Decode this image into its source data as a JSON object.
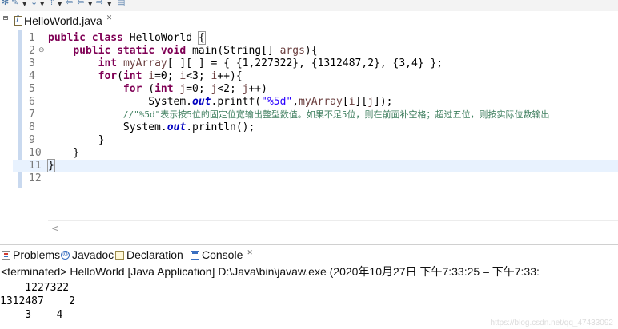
{
  "editor": {
    "tab_label": "HelloWorld.java",
    "tab_close": "✕",
    "lines": [
      {
        "num": "1",
        "fold": "",
        "segments": [
          [
            "kw",
            "public class "
          ],
          [
            "",
            "HelloWorld "
          ],
          [
            "brace",
            "{"
          ]
        ]
      },
      {
        "num": "2",
        "fold": "⊖",
        "segments": [
          [
            "",
            "    "
          ],
          [
            "kw",
            "public static void "
          ],
          [
            "",
            "main(String[] "
          ],
          [
            "var",
            "args"
          ],
          [
            "",
            "){"
          ]
        ]
      },
      {
        "num": "3",
        "fold": "",
        "segments": [
          [
            "",
            "        "
          ],
          [
            "kw",
            "int "
          ],
          [
            "var",
            "myArray"
          ],
          [
            "",
            "[ ][ ] = { {1,227322}, {1312487,2}, {3,4} };"
          ]
        ]
      },
      {
        "num": "4",
        "fold": "",
        "segments": [
          [
            "",
            "        "
          ],
          [
            "kw",
            "for"
          ],
          [
            "",
            "("
          ],
          [
            "kw",
            "int "
          ],
          [
            "var",
            "i"
          ],
          [
            "",
            "=0; "
          ],
          [
            "var",
            "i"
          ],
          [
            "",
            "<3; "
          ],
          [
            "var",
            "i"
          ],
          [
            "",
            "++){"
          ]
        ]
      },
      {
        "num": "5",
        "fold": "",
        "segments": [
          [
            "",
            "            "
          ],
          [
            "kw",
            "for "
          ],
          [
            "",
            "("
          ],
          [
            "kw",
            "int "
          ],
          [
            "var",
            "j"
          ],
          [
            "",
            "=0; "
          ],
          [
            "var",
            "j"
          ],
          [
            "",
            "<2; "
          ],
          [
            "var",
            "j"
          ],
          [
            "",
            "++)"
          ]
        ]
      },
      {
        "num": "6",
        "fold": "",
        "segments": [
          [
            "",
            "                System."
          ],
          [
            "fld",
            "out"
          ],
          [
            "",
            ".printf("
          ],
          [
            "str",
            "\"%5d\""
          ],
          [
            "",
            ","
          ],
          [
            "var",
            "myArray"
          ],
          [
            "",
            "["
          ],
          [
            "var",
            "i"
          ],
          [
            "",
            "]["
          ],
          [
            "var",
            "j"
          ],
          [
            "",
            "]);"
          ]
        ]
      },
      {
        "num": "7",
        "fold": "",
        "segments": [
          [
            "",
            "            "
          ],
          [
            "cmt",
            "//\"%5d\"表示按5位的固定位宽输出整型数值。如果不足5位，则在前面补空格；超过五位，则按实际位数输出"
          ]
        ]
      },
      {
        "num": "8",
        "fold": "",
        "segments": [
          [
            "",
            "            System."
          ],
          [
            "fld",
            "out"
          ],
          [
            "",
            ".println();"
          ]
        ]
      },
      {
        "num": "9",
        "fold": "",
        "segments": [
          [
            "",
            "        }"
          ]
        ]
      },
      {
        "num": "10",
        "fold": "",
        "segments": [
          [
            "",
            "    }"
          ]
        ]
      },
      {
        "num": "11",
        "fold": "",
        "segments": [
          [
            "brace",
            "}"
          ]
        ]
      },
      {
        "num": "12",
        "fold": "",
        "segments": []
      }
    ],
    "current_line_index": 10,
    "hscroll_arrow": "<"
  },
  "views": {
    "tabs": [
      {
        "name": "tab-problems",
        "icon": "problems-icon",
        "label": "Problems"
      },
      {
        "name": "tab-javadoc",
        "icon": "javadoc-icon",
        "label": "Javadoc"
      },
      {
        "name": "tab-declaration",
        "icon": "declaration-icon",
        "label": "Declaration"
      },
      {
        "name": "tab-console",
        "icon": "console-icon",
        "label": "Console"
      }
    ],
    "console_close": "✕"
  },
  "console": {
    "status": "<terminated> HelloWorld [Java Application] D:\\Java\\bin\\javaw.exe  (2020年10月27日 下午7:33:25 – 下午7:33:",
    "output_lines": [
      "    1227322",
      "1312487    2",
      "    3    4"
    ]
  },
  "watermark": "https://blog.csdn.net/qq_47433092"
}
